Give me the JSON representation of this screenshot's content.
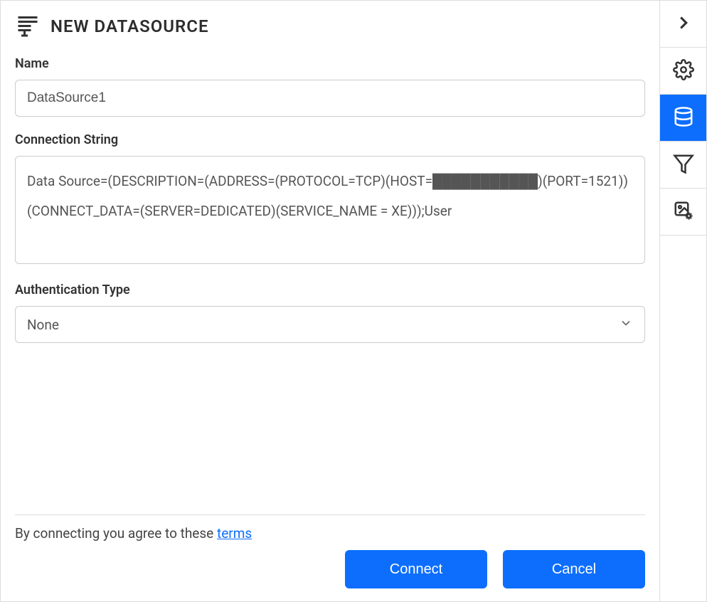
{
  "header": {
    "title": "NEW DATASOURCE"
  },
  "form": {
    "name": {
      "label": "Name",
      "value": "DataSource1"
    },
    "connectionString": {
      "label": "Connection String",
      "value": "Data Source=(DESCRIPTION=(ADDRESS=(PROTOCOL=TCP)(HOST=███████████)(PORT=1521))(CONNECT_DATA=(SERVER=DEDICATED)(SERVICE_NAME = XE)));User"
    },
    "authType": {
      "label": "Authentication Type",
      "value": "None"
    }
  },
  "footer": {
    "agreeText": "By connecting you agree to these ",
    "termsLink": "terms",
    "connectButton": "Connect",
    "cancelButton": "Cancel"
  },
  "sideRail": {
    "items": [
      {
        "name": "expand-arrow-icon"
      },
      {
        "name": "settings-gear-icon"
      },
      {
        "name": "datasource-database-icon",
        "active": true
      },
      {
        "name": "filter-funnel-icon"
      },
      {
        "name": "image-settings-icon"
      }
    ]
  }
}
